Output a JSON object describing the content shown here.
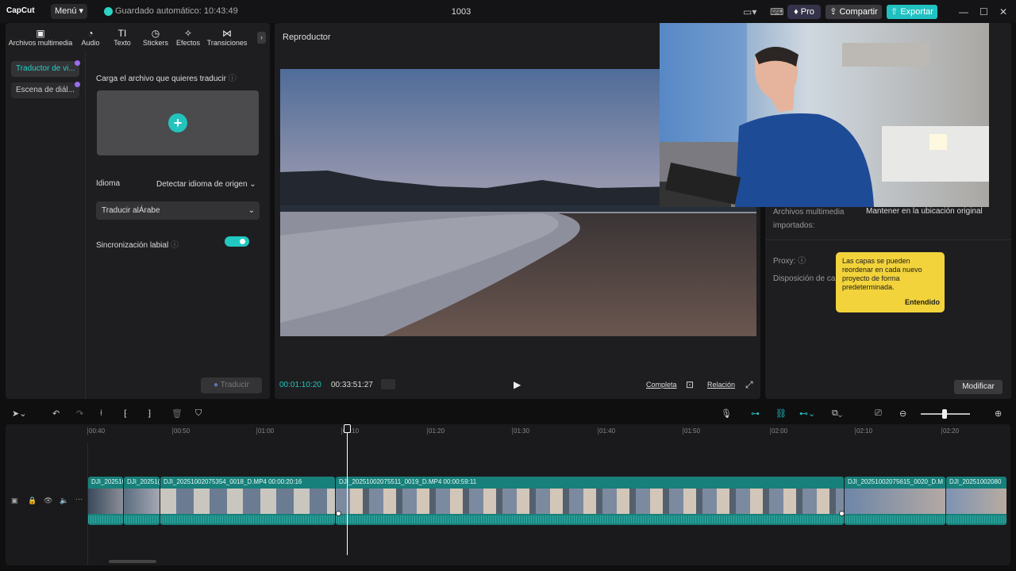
{
  "app": {
    "logo": "CapCut",
    "menu_label": "Menú",
    "autosave_text": "Guardado automático: 10:43:49",
    "project_title": "1003",
    "pro_label": "Pro",
    "share_label": "Compartir",
    "export_label": "Exportar"
  },
  "media_tabs": [
    {
      "label": "Archivos multimedia",
      "icon": "media-icon"
    },
    {
      "label": "Audio",
      "icon": "audio-icon"
    },
    {
      "label": "Texto",
      "icon": "text-icon"
    },
    {
      "label": "Stickers",
      "icon": "sticker-icon"
    },
    {
      "label": "Efectos",
      "icon": "effects-icon"
    },
    {
      "label": "Transiciones",
      "icon": "transitions-icon"
    }
  ],
  "sidebar": {
    "items": [
      {
        "label": "Traductor de vi..."
      },
      {
        "label": "Escena de diál..."
      }
    ]
  },
  "translator": {
    "upload_label": "Carga el archivo que quieres traducir",
    "language_label": "Idioma",
    "language_value": "Detectar idioma de origen",
    "translate_to": "Traducir alÁrabe",
    "lipsync_label": "Sincronización labial",
    "lipsync_on": true,
    "translate_button": "Traducir"
  },
  "player": {
    "title": "Reproductor",
    "current_time": "00:01:10:20",
    "total_time": "00:33:51:27",
    "full_label": "Completa",
    "ratio_label": "Relación"
  },
  "properties": {
    "imported_label_1": "Archivos multimedia",
    "imported_label_2": "importados:",
    "imported_value": "Mantener en la ubicación original",
    "proxy_label": "Proxy:",
    "layout_label": "Disposición de ca",
    "tooltip_text": "Las capas se pueden reordenar en cada nuevo proyecto de forma predeterminada.",
    "tooltip_ok": "Entendido",
    "modify_button": "Modificar"
  },
  "timeline": {
    "ruler": [
      "00:40",
      "00:50",
      "01:00",
      "01:10",
      "01:20",
      "01:30",
      "01:40",
      "01:50",
      "02:00",
      "02:10",
      "02:20"
    ],
    "clips": [
      {
        "label": "DJI_202510("
      },
      {
        "label": "DJI_20251("
      },
      {
        "label": "DJI_20251002075354_0018_D.MP4   00:00:20:16"
      },
      {
        "label": "DJI_20251002075511_0019_D.MP4   00:00:59:11"
      },
      {
        "label": "DJI_20251002075615_0020_D.M"
      },
      {
        "label": "DJI_20251002080"
      }
    ]
  },
  "colors": {
    "accent": "#21c1c1",
    "clip": "#17807a",
    "tooltip": "#f2d33b"
  }
}
